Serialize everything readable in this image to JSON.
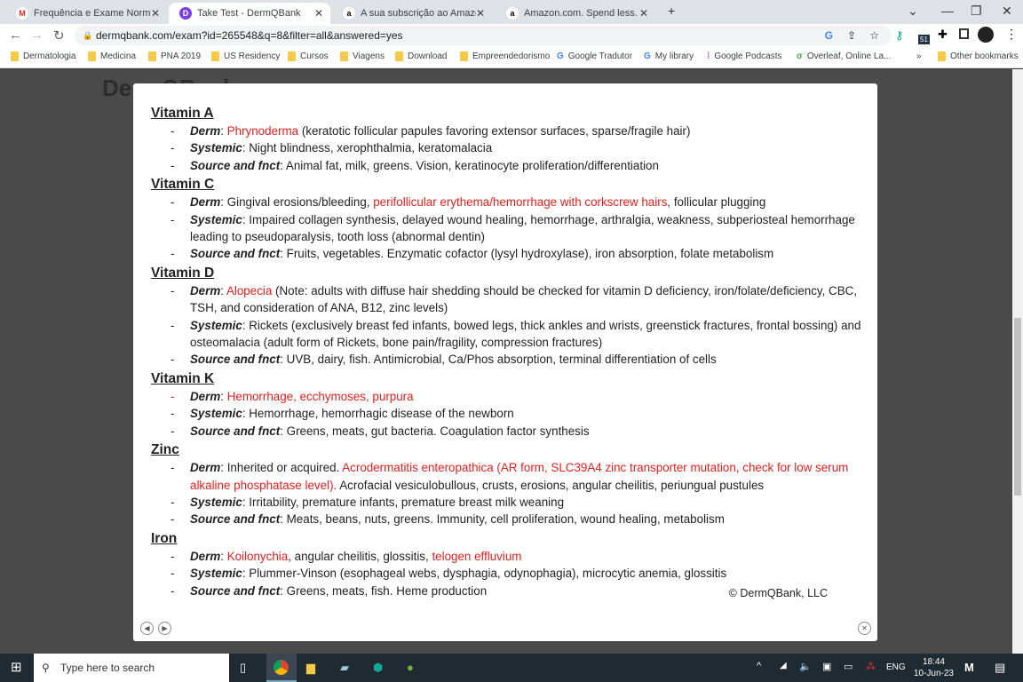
{
  "browser": {
    "tabs": [
      {
        "label": "Frequência e Exame Normal Anat",
        "icon": "gmail-icon",
        "active": false
      },
      {
        "label": "Take Test - DermQBank",
        "icon": "dermqbank-icon",
        "active": true
      },
      {
        "label": "A sua subscrição ao Amazon Prim",
        "icon": "amazon-icon",
        "active": false
      },
      {
        "label": "Amazon.com. Spend less. Smile m",
        "icon": "amazon-icon",
        "active": false
      }
    ],
    "url": "dermqbank.com/exam?id=265548&q=8&filter=all&answered=yes",
    "extension_badge": "51",
    "bookmarks": [
      "Dermatologia",
      "Medicina",
      "PNA 2019",
      "US Residency",
      "Cursos",
      "Viagens",
      "Download",
      "Empreendedorismo",
      "Google Tradutor",
      "My library",
      "Google Podcasts",
      "Overleaf, Online La..."
    ],
    "other_bookmarks": "Other bookmarks"
  },
  "background_page": {
    "title": "DermQBank"
  },
  "modal": {
    "sections": [
      {
        "title": "Vitamin A",
        "items": [
          {
            "label": "Derm",
            "segs": [
              {
                "t": "Phrynoderma",
                "r": true
              },
              {
                "t": " (keratotic follicular papules favoring extensor surfaces, sparse/fragile hair)"
              }
            ]
          },
          {
            "label": "Systemic",
            "segs": [
              {
                "t": "Night blindness, xerophthalmia, keratomalacia"
              }
            ]
          },
          {
            "label": "Source and fnct",
            "segs": [
              {
                "t": "Animal fat, milk, greens. Vision, keratinocyte proliferation/differentiation"
              }
            ]
          }
        ]
      },
      {
        "title": "Vitamin C",
        "items": [
          {
            "label": "Derm",
            "segs": [
              {
                "t": "Gingival erosions/bleeding, "
              },
              {
                "t": "perifollicular erythema/hemorrhage with corkscrew hairs",
                "r": true
              },
              {
                "t": ", follicular plugging"
              }
            ]
          },
          {
            "label": "Systemic",
            "segs": [
              {
                "t": "Impaired collagen synthesis, delayed wound healing, hemorrhage, arthralgia, weakness, subperiosteal hemorrhage leading to pseudoparalysis, tooth loss (abnormal dentin)"
              }
            ]
          },
          {
            "label": "Source and fnct",
            "segs": [
              {
                "t": "Fruits, vegetables. Enzymatic cofactor (lysyl hydroxylase), iron absorption, folate metabolism"
              }
            ]
          }
        ]
      },
      {
        "title": "Vitamin D",
        "items": [
          {
            "label": "Derm",
            "segs": [
              {
                "t": "Alopecia",
                "r": true
              },
              {
                "t": " (Note: adults with diffuse hair shedding should be checked for vitamin D deficiency, iron/folate/deficiency, CBC, TSH, and consideration of ANA, B12, zinc levels)"
              }
            ]
          },
          {
            "label": "Systemic",
            "segs": [
              {
                "t": "Rickets (exclusively breast fed infants, bowed legs, thick ankles and wrists, greenstick fractures, frontal bossing) and osteomalacia (adult form of Rickets, bone pain/fragility, compression fractures)"
              }
            ]
          },
          {
            "label": "Source and fnct",
            "segs": [
              {
                "t": "UVB, dairy, fish. Antimicrobial, Ca/Phos absorption, terminal differentiation of cells"
              }
            ]
          }
        ]
      },
      {
        "title": "Vitamin K",
        "items": [
          {
            "label": "Derm",
            "red_dash": true,
            "segs": [
              {
                "t": "Hemorrhage, ecchymoses, purpura",
                "r": true
              }
            ]
          },
          {
            "label": "Systemic",
            "segs": [
              {
                "t": "Hemorrhage, hemorrhagic disease of the newborn"
              }
            ]
          },
          {
            "label": "Source and fnct",
            "segs": [
              {
                "t": "Greens, meats, gut bacteria. Coagulation factor synthesis"
              }
            ]
          }
        ]
      },
      {
        "title": "Zinc",
        "items": [
          {
            "label": "Derm",
            "segs": [
              {
                "t": "Inherited or acquired. "
              },
              {
                "t": "Acrodermatitis enteropathica (AR form, SLC39A4 zinc transporter mutation, check for low serum alkaline phosphatase level).",
                "r": true
              },
              {
                "t": " Acrofacial vesiculobullous, crusts, erosions, angular cheilitis, periungual pustules"
              }
            ]
          },
          {
            "label": "Systemic",
            "segs": [
              {
                "t": "Irritability, premature infants, premature breast milk weaning"
              }
            ]
          },
          {
            "label": "Source and fnct",
            "segs": [
              {
                "t": "Meats, beans, nuts, greens. Immunity, cell proliferation, wound healing, metabolism"
              }
            ]
          }
        ]
      },
      {
        "title": "Iron",
        "items": [
          {
            "label": "Derm",
            "segs": [
              {
                "t": "Koilonychia",
                "r": true
              },
              {
                "t": ", angular cheilitis, glossitis, "
              },
              {
                "t": "telogen effluvium",
                "r": true
              }
            ]
          },
          {
            "label": "Systemic",
            "segs": [
              {
                "t": "Plummer-Vinson (esophageal webs, dysphagia, odynophagia), microcytic anemia, glossitis"
              }
            ]
          },
          {
            "label": "Source and fnct",
            "segs": [
              {
                "t": "Greens, meats, fish. Heme production"
              }
            ]
          }
        ]
      }
    ],
    "copyright": "© DermQBank, LLC",
    "red_color": "#e02020"
  },
  "taskbar": {
    "search_placeholder": "Type here to search",
    "lang": "ENG",
    "time": "18:44",
    "date": "10-Jun-23"
  }
}
